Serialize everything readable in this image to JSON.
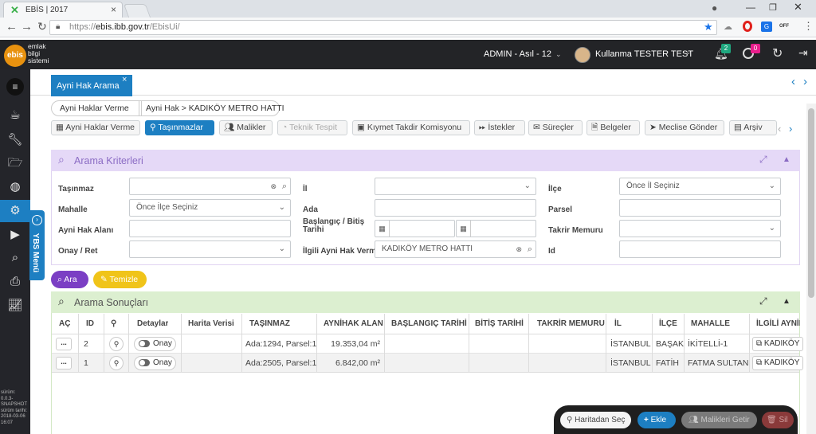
{
  "browser": {
    "tab_title": "EBİS | 2017",
    "url_scheme": "https://",
    "url_host": "ebis.ibb.gov.tr",
    "url_path": "/EbisUi/",
    "ext_badge": "OFF"
  },
  "app": {
    "logo_text": "ebis",
    "logo_line1": "emlak",
    "logo_line2": "bilgi",
    "logo_line3": "sistemi",
    "user_context": "ADMIN - Asıl - 12",
    "user_name": "Kullanma TESTER TEST",
    "notif_count": "2",
    "alert_count": "0"
  },
  "version": {
    "l1": "sürüm:",
    "l2": "0.0.3-",
    "l3": "SNAPSHOT",
    "l4": "sürüm tarihi:",
    "l5": "2018-03-06",
    "l6": "16:07"
  },
  "ybs_label": "YBS Menü",
  "page_tab": {
    "label": "Ayni Hak Arama",
    "close": "×"
  },
  "breadcrumb": [
    "Ayni Haklar Verme",
    "Ayni Hak > KADIKÖY METRO HATTI"
  ],
  "subtabs": [
    {
      "label": "Ayni Haklar Verme"
    },
    {
      "label": "Taşınmazlar"
    },
    {
      "label": "Malikler"
    },
    {
      "label": "Teknik Tespit"
    },
    {
      "label": "Kıymet Takdir Komisyonu"
    },
    {
      "label": "İstekler"
    },
    {
      "label": "Süreçler"
    },
    {
      "label": "Belgeler"
    },
    {
      "label": "Meclise Gönder"
    },
    {
      "label": "Arşiv"
    }
  ],
  "criteria": {
    "title": "Arama Kriterleri",
    "tasinmaz_label": "Taşınmaz",
    "il_label": "İl",
    "ilce_label": "İlçe",
    "ilce_value": "Önce İl Seçiniz",
    "mahalle_label": "Mahalle",
    "mahalle_value": "Önce İlçe Seçiniz",
    "ada_label": "Ada",
    "parsel_label": "Parsel",
    "ayni_hak_alani_label": "Ayni Hak Alanı",
    "baslangic_label_1": "Başlangıç / Bitiş",
    "baslangic_label_2": "Tarihi",
    "takrir_label": "Takrir Memuru",
    "onay_label": "Onay / Ret",
    "ilgili_label": "İlgili Ayni Hak Verme",
    "ilgili_value": "KADIKÖY METRO HATTI",
    "id_label": "Id",
    "search_btn": "Ara",
    "clear_btn": "Temizle"
  },
  "results": {
    "title": "Arama Sonuçları",
    "columns": [
      "AÇ",
      "ID",
      "",
      "Detaylar",
      "Harita Verisi",
      "TAŞINMAZ",
      "AYNİHAK ALAN",
      "BAŞLANGIÇ TARİHİ",
      "BİTİŞ TARİHİ",
      "TAKRİR MEMURU",
      "İL",
      "İLÇE",
      "MAHALLE",
      "İLGİLİ AYNİH"
    ],
    "rows": [
      {
        "id": "2",
        "detail": "Onay",
        "tasinmaz": "Ada:1294, Parsel:1",
        "alan": "19.353,04 m²",
        "il": "İSTANBUL",
        "ilce": "BAŞAKŞ",
        "mahalle": "İKİTELLİ-1",
        "ilgili": "KADIKÖY"
      },
      {
        "id": "1",
        "detail": "Onay",
        "tasinmaz": "Ada:2505, Parsel:1",
        "alan": "6.842,00 m²",
        "il": "İSTANBUL",
        "ilce": "FATİH",
        "mahalle": "FATMA SULTAN",
        "ilgili": "KADIKÖY"
      }
    ],
    "more_btn": "..."
  },
  "footer_bar": {
    "map_select": "Haritadan Seç",
    "add": "Ekle",
    "get_owners": "Malikleri Getir",
    "delete": "Sil"
  },
  "colors": {
    "criteria_header": "#e5d9f7",
    "results_header": "#dcefd0",
    "primary": "#1d7fc2",
    "search_btn": "#7b3fc4",
    "clear_btn": "#f0c419"
  }
}
